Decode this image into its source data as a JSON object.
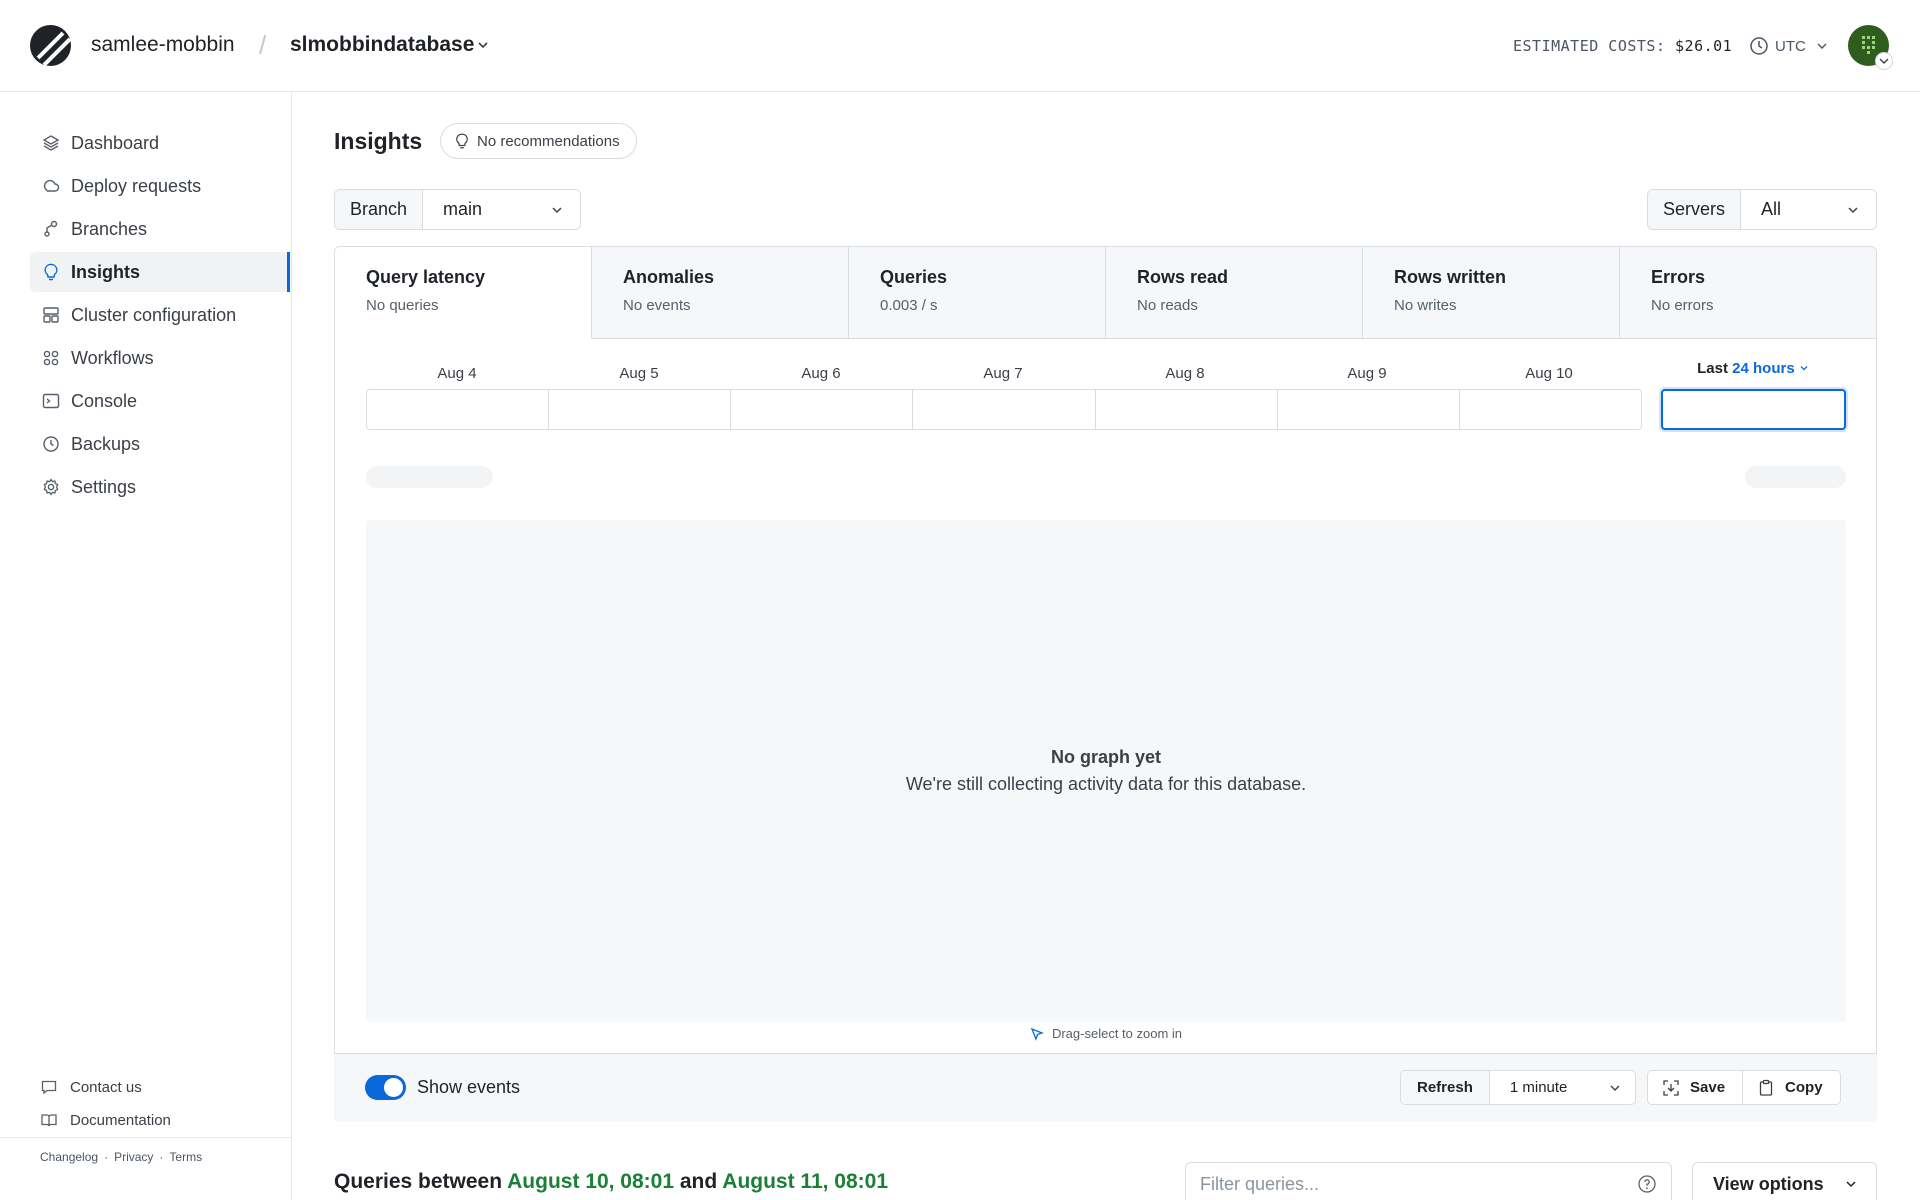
{
  "header": {
    "org": "samlee-mobbin",
    "separator": "/",
    "database": "slmobbindatabase",
    "costs_label": "ESTIMATED COSTS:",
    "costs_value": "$26.01",
    "timezone": "UTC"
  },
  "sidebar": {
    "items": [
      {
        "label": "Dashboard",
        "icon": "layers-icon"
      },
      {
        "label": "Deploy requests",
        "icon": "deploy-icon"
      },
      {
        "label": "Branches",
        "icon": "branch-icon"
      },
      {
        "label": "Insights",
        "icon": "lightbulb-icon",
        "active": true
      },
      {
        "label": "Cluster configuration",
        "icon": "cluster-icon"
      },
      {
        "label": "Workflows",
        "icon": "workflow-icon"
      },
      {
        "label": "Console",
        "icon": "terminal-icon"
      },
      {
        "label": "Backups",
        "icon": "clock-icon"
      },
      {
        "label": "Settings",
        "icon": "gear-icon"
      }
    ],
    "footer": {
      "contact": "Contact us",
      "docs": "Documentation",
      "changelog": "Changelog",
      "privacy": "Privacy",
      "terms": "Terms"
    }
  },
  "main": {
    "title": "Insights",
    "recommendations": "No recommendations",
    "branch_label": "Branch",
    "branch_value": "main",
    "servers_label": "Servers",
    "servers_value": "All",
    "tabs": [
      {
        "title": "Query latency",
        "sub": "No queries"
      },
      {
        "title": "Anomalies",
        "sub": "No events"
      },
      {
        "title": "Queries",
        "sub": "0.003 / s"
      },
      {
        "title": "Rows read",
        "sub": "No reads"
      },
      {
        "title": "Rows written",
        "sub": "No writes"
      },
      {
        "title": "Errors",
        "sub": "No errors"
      }
    ],
    "days": [
      "Aug 4",
      "Aug 5",
      "Aug 6",
      "Aug 7",
      "Aug 8",
      "Aug 9",
      "Aug 10"
    ],
    "range_prefix": "Last",
    "range_value": "24 hours",
    "no_graph_title": "No graph yet",
    "no_graph_sub": "We're still collecting activity data for this database.",
    "drag_hint": "Drag-select to zoom in",
    "show_events": "Show events",
    "refresh_label": "Refresh",
    "refresh_value": "1 minute",
    "save": "Save",
    "copy": "Copy",
    "queries_between": "Queries between",
    "range_start": "August 10, 08:01",
    "and": "and",
    "range_end": "August 11, 08:01",
    "filter_placeholder": "Filter queries...",
    "view_options": "View options"
  },
  "colors": {
    "accent": "#0969da",
    "date_highlight": "#1a7f37",
    "avatar": "#2f5d1e"
  }
}
